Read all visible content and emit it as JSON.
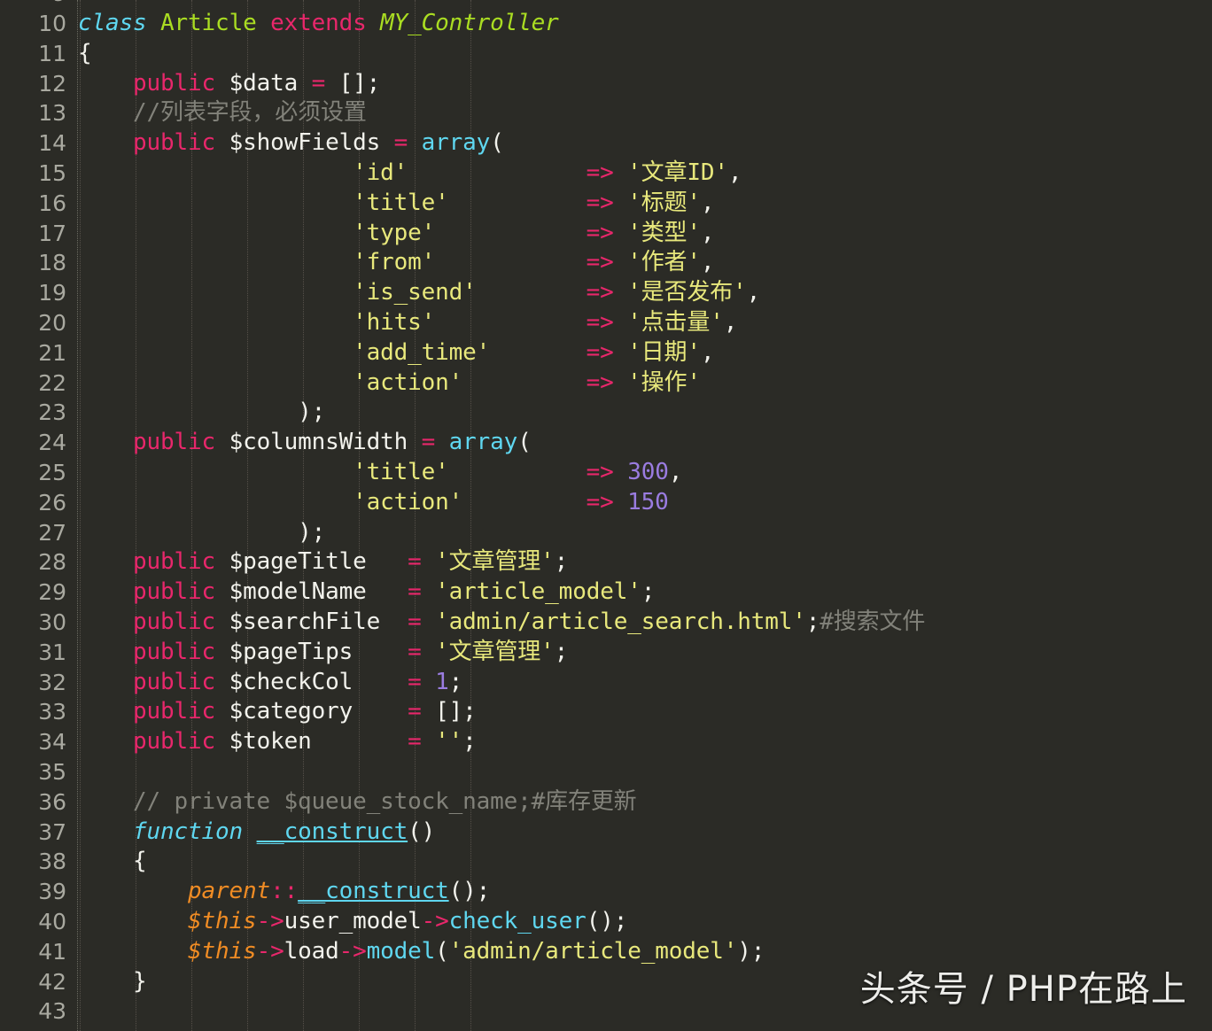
{
  "editor": {
    "language": "PHP",
    "background_color": "#2b2b26",
    "gutter_color": "#a9a9a0",
    "first_visible_line": 10,
    "last_visible_line": 43,
    "line_height_px": 33.8,
    "font_size_px": 26
  },
  "palette": {
    "keyword": "#e8276b",
    "control": "#5fd7f0",
    "class_name": "#aadd22",
    "variable": "#f2f2ec",
    "function": "#5fd7f0",
    "string": "#e8e87c",
    "number": "#9a7ce0",
    "operator": "#e8276b",
    "comment": "#82827a",
    "this_ref": "#f08c24",
    "indent_guide": "#555049"
  },
  "line_numbers": [
    10,
    11,
    12,
    13,
    14,
    15,
    16,
    17,
    18,
    19,
    20,
    21,
    22,
    23,
    24,
    25,
    26,
    27,
    28,
    29,
    30,
    31,
    32,
    33,
    34,
    35,
    36,
    37,
    38,
    39,
    40,
    41,
    42,
    43
  ],
  "code_lines": [
    {
      "n": 10,
      "text": "class Article extends MY_Controller",
      "tokens": [
        {
          "t": "class",
          "c": "t-ctrl"
        },
        {
          "t": " ",
          "c": "t-punc"
        },
        {
          "t": "Article",
          "c": "t-class"
        },
        {
          "t": " ",
          "c": "t-punc"
        },
        {
          "t": "extends",
          "c": "t-kw"
        },
        {
          "t": " ",
          "c": "t-punc"
        },
        {
          "t": "MY_Controller",
          "c": "t-classi"
        }
      ],
      "indent": 0
    },
    {
      "n": 11,
      "text": "{",
      "tokens": [
        {
          "t": "{",
          "c": "t-punc"
        }
      ],
      "indent": 0
    },
    {
      "n": 12,
      "text": "    public $data = [];",
      "tokens": [
        {
          "t": "    ",
          "c": "t-punc"
        },
        {
          "t": "public",
          "c": "t-kw"
        },
        {
          "t": " ",
          "c": "t-punc"
        },
        {
          "t": "$data",
          "c": "t-var"
        },
        {
          "t": " ",
          "c": "t-punc"
        },
        {
          "t": "=",
          "c": "t-op"
        },
        {
          "t": " ",
          "c": "t-punc"
        },
        {
          "t": "[];",
          "c": "t-punc"
        }
      ],
      "indent": 1
    },
    {
      "n": 13,
      "text": "    //列表字段，必须设置",
      "tokens": [
        {
          "t": "    ",
          "c": "t-punc"
        },
        {
          "t": "//列表字段，必须设置",
          "c": "t-cmt"
        }
      ],
      "indent": 1
    },
    {
      "n": 14,
      "text": "    public $showFields = array(",
      "tokens": [
        {
          "t": "    ",
          "c": "t-punc"
        },
        {
          "t": "public",
          "c": "t-kw"
        },
        {
          "t": " ",
          "c": "t-punc"
        },
        {
          "t": "$showFields",
          "c": "t-var"
        },
        {
          "t": " ",
          "c": "t-punc"
        },
        {
          "t": "=",
          "c": "t-op"
        },
        {
          "t": " ",
          "c": "t-punc"
        },
        {
          "t": "array",
          "c": "t-fn"
        },
        {
          "t": "(",
          "c": "t-punc"
        }
      ],
      "indent": 1
    },
    {
      "n": 15,
      "text": "                    'id'           => '文章ID',",
      "tokens": [
        {
          "t": "                    ",
          "c": "t-punc"
        },
        {
          "t": "'id'",
          "c": "t-str"
        },
        {
          "t": "             ",
          "c": "t-punc"
        },
        {
          "t": "=>",
          "c": "t-op"
        },
        {
          "t": " ",
          "c": "t-punc"
        },
        {
          "t": "'文章ID'",
          "c": "t-str"
        },
        {
          "t": ",",
          "c": "t-punc"
        }
      ],
      "indent": 5
    },
    {
      "n": 16,
      "text": "                    'title'        => '标题',",
      "tokens": [
        {
          "t": "                    ",
          "c": "t-punc"
        },
        {
          "t": "'title'",
          "c": "t-str"
        },
        {
          "t": "          ",
          "c": "t-punc"
        },
        {
          "t": "=>",
          "c": "t-op"
        },
        {
          "t": " ",
          "c": "t-punc"
        },
        {
          "t": "'标题'",
          "c": "t-str"
        },
        {
          "t": ",",
          "c": "t-punc"
        }
      ],
      "indent": 5
    },
    {
      "n": 17,
      "text": "                    'type'         => '类型',",
      "tokens": [
        {
          "t": "                    ",
          "c": "t-punc"
        },
        {
          "t": "'type'",
          "c": "t-str"
        },
        {
          "t": "           ",
          "c": "t-punc"
        },
        {
          "t": "=>",
          "c": "t-op"
        },
        {
          "t": " ",
          "c": "t-punc"
        },
        {
          "t": "'类型'",
          "c": "t-str"
        },
        {
          "t": ",",
          "c": "t-punc"
        }
      ],
      "indent": 5
    },
    {
      "n": 18,
      "text": "                    'from'         => '作者',",
      "tokens": [
        {
          "t": "                    ",
          "c": "t-punc"
        },
        {
          "t": "'from'",
          "c": "t-str"
        },
        {
          "t": "           ",
          "c": "t-punc"
        },
        {
          "t": "=>",
          "c": "t-op"
        },
        {
          "t": " ",
          "c": "t-punc"
        },
        {
          "t": "'作者'",
          "c": "t-str"
        },
        {
          "t": ",",
          "c": "t-punc"
        }
      ],
      "indent": 5
    },
    {
      "n": 19,
      "text": "                    'is_send'      => '是否发布',",
      "tokens": [
        {
          "t": "                    ",
          "c": "t-punc"
        },
        {
          "t": "'is_send'",
          "c": "t-str"
        },
        {
          "t": "        ",
          "c": "t-punc"
        },
        {
          "t": "=>",
          "c": "t-op"
        },
        {
          "t": " ",
          "c": "t-punc"
        },
        {
          "t": "'是否发布'",
          "c": "t-str"
        },
        {
          "t": ",",
          "c": "t-punc"
        }
      ],
      "indent": 5
    },
    {
      "n": 20,
      "text": "                    'hits'         => '点击量',",
      "tokens": [
        {
          "t": "                    ",
          "c": "t-punc"
        },
        {
          "t": "'hits'",
          "c": "t-str"
        },
        {
          "t": "           ",
          "c": "t-punc"
        },
        {
          "t": "=>",
          "c": "t-op"
        },
        {
          "t": " ",
          "c": "t-punc"
        },
        {
          "t": "'点击量'",
          "c": "t-str"
        },
        {
          "t": ",",
          "c": "t-punc"
        }
      ],
      "indent": 5
    },
    {
      "n": 21,
      "text": "                    'add_time'     => '日期',",
      "tokens": [
        {
          "t": "                    ",
          "c": "t-punc"
        },
        {
          "t": "'add_time'",
          "c": "t-str"
        },
        {
          "t": "       ",
          "c": "t-punc"
        },
        {
          "t": "=>",
          "c": "t-op"
        },
        {
          "t": " ",
          "c": "t-punc"
        },
        {
          "t": "'日期'",
          "c": "t-str"
        },
        {
          "t": ",",
          "c": "t-punc"
        }
      ],
      "indent": 5
    },
    {
      "n": 22,
      "text": "                    'action'       => '操作'",
      "tokens": [
        {
          "t": "                    ",
          "c": "t-punc"
        },
        {
          "t": "'action'",
          "c": "t-str"
        },
        {
          "t": "         ",
          "c": "t-punc"
        },
        {
          "t": "=>",
          "c": "t-op"
        },
        {
          "t": " ",
          "c": "t-punc"
        },
        {
          "t": "'操作'",
          "c": "t-str"
        }
      ],
      "indent": 5
    },
    {
      "n": 23,
      "text": "                );",
      "tokens": [
        {
          "t": "                ",
          "c": "t-punc"
        },
        {
          "t": ");",
          "c": "t-punc"
        }
      ],
      "indent": 4
    },
    {
      "n": 24,
      "text": "    public $columnsWidth = array(",
      "tokens": [
        {
          "t": "    ",
          "c": "t-punc"
        },
        {
          "t": "public",
          "c": "t-kw"
        },
        {
          "t": " ",
          "c": "t-punc"
        },
        {
          "t": "$columnsWidth",
          "c": "t-var"
        },
        {
          "t": " ",
          "c": "t-punc"
        },
        {
          "t": "=",
          "c": "t-op"
        },
        {
          "t": " ",
          "c": "t-punc"
        },
        {
          "t": "array",
          "c": "t-fn"
        },
        {
          "t": "(",
          "c": "t-punc"
        }
      ],
      "indent": 1
    },
    {
      "n": 25,
      "text": "                    'title'        => 300,",
      "tokens": [
        {
          "t": "                    ",
          "c": "t-punc"
        },
        {
          "t": "'title'",
          "c": "t-str"
        },
        {
          "t": "          ",
          "c": "t-punc"
        },
        {
          "t": "=>",
          "c": "t-op"
        },
        {
          "t": " ",
          "c": "t-punc"
        },
        {
          "t": "300",
          "c": "t-num"
        },
        {
          "t": ",",
          "c": "t-punc"
        }
      ],
      "indent": 5
    },
    {
      "n": 26,
      "text": "                    'action'       => 150",
      "tokens": [
        {
          "t": "                    ",
          "c": "t-punc"
        },
        {
          "t": "'action'",
          "c": "t-str"
        },
        {
          "t": "         ",
          "c": "t-punc"
        },
        {
          "t": "=>",
          "c": "t-op"
        },
        {
          "t": " ",
          "c": "t-punc"
        },
        {
          "t": "150",
          "c": "t-num"
        }
      ],
      "indent": 5
    },
    {
      "n": 27,
      "text": "                );",
      "tokens": [
        {
          "t": "                ",
          "c": "t-punc"
        },
        {
          "t": ");",
          "c": "t-punc"
        }
      ],
      "indent": 4
    },
    {
      "n": 28,
      "text": "    public $pageTitle   = '文章管理';",
      "tokens": [
        {
          "t": "    ",
          "c": "t-punc"
        },
        {
          "t": "public",
          "c": "t-kw"
        },
        {
          "t": " ",
          "c": "t-punc"
        },
        {
          "t": "$pageTitle",
          "c": "t-var"
        },
        {
          "t": "   ",
          "c": "t-punc"
        },
        {
          "t": "=",
          "c": "t-op"
        },
        {
          "t": " ",
          "c": "t-punc"
        },
        {
          "t": "'文章管理'",
          "c": "t-str"
        },
        {
          "t": ";",
          "c": "t-punc"
        }
      ],
      "indent": 1
    },
    {
      "n": 29,
      "text": "    public $modelName   = 'article_model';",
      "tokens": [
        {
          "t": "    ",
          "c": "t-punc"
        },
        {
          "t": "public",
          "c": "t-kw"
        },
        {
          "t": " ",
          "c": "t-punc"
        },
        {
          "t": "$modelName",
          "c": "t-var"
        },
        {
          "t": "   ",
          "c": "t-punc"
        },
        {
          "t": "=",
          "c": "t-op"
        },
        {
          "t": " ",
          "c": "t-punc"
        },
        {
          "t": "'article_model'",
          "c": "t-str"
        },
        {
          "t": ";",
          "c": "t-punc"
        }
      ],
      "indent": 1
    },
    {
      "n": 30,
      "text": "    public $searchFile  = 'admin/article_search.html';#搜索文件",
      "tokens": [
        {
          "t": "    ",
          "c": "t-punc"
        },
        {
          "t": "public",
          "c": "t-kw"
        },
        {
          "t": " ",
          "c": "t-punc"
        },
        {
          "t": "$searchFile",
          "c": "t-var"
        },
        {
          "t": "  ",
          "c": "t-punc"
        },
        {
          "t": "=",
          "c": "t-op"
        },
        {
          "t": " ",
          "c": "t-punc"
        },
        {
          "t": "'admin/article_search.html'",
          "c": "t-str"
        },
        {
          "t": ";",
          "c": "t-punc"
        },
        {
          "t": "#搜索文件",
          "c": "t-cmt"
        }
      ],
      "indent": 1
    },
    {
      "n": 31,
      "text": "    public $pageTips    = '文章管理';",
      "tokens": [
        {
          "t": "    ",
          "c": "t-punc"
        },
        {
          "t": "public",
          "c": "t-kw"
        },
        {
          "t": " ",
          "c": "t-punc"
        },
        {
          "t": "$pageTips",
          "c": "t-var"
        },
        {
          "t": "    ",
          "c": "t-punc"
        },
        {
          "t": "=",
          "c": "t-op"
        },
        {
          "t": " ",
          "c": "t-punc"
        },
        {
          "t": "'文章管理'",
          "c": "t-str"
        },
        {
          "t": ";",
          "c": "t-punc"
        }
      ],
      "indent": 1
    },
    {
      "n": 32,
      "text": "    public $checkCol    = 1;",
      "tokens": [
        {
          "t": "    ",
          "c": "t-punc"
        },
        {
          "t": "public",
          "c": "t-kw"
        },
        {
          "t": " ",
          "c": "t-punc"
        },
        {
          "t": "$checkCol",
          "c": "t-var"
        },
        {
          "t": "    ",
          "c": "t-punc"
        },
        {
          "t": "=",
          "c": "t-op"
        },
        {
          "t": " ",
          "c": "t-punc"
        },
        {
          "t": "1",
          "c": "t-num"
        },
        {
          "t": ";",
          "c": "t-punc"
        }
      ],
      "indent": 1
    },
    {
      "n": 33,
      "text": "    public $category    = [];",
      "tokens": [
        {
          "t": "    ",
          "c": "t-punc"
        },
        {
          "t": "public",
          "c": "t-kw"
        },
        {
          "t": " ",
          "c": "t-punc"
        },
        {
          "t": "$category",
          "c": "t-var"
        },
        {
          "t": "    ",
          "c": "t-punc"
        },
        {
          "t": "=",
          "c": "t-op"
        },
        {
          "t": " ",
          "c": "t-punc"
        },
        {
          "t": "[];",
          "c": "t-punc"
        }
      ],
      "indent": 1
    },
    {
      "n": 34,
      "text": "    public $token       = '';",
      "tokens": [
        {
          "t": "    ",
          "c": "t-punc"
        },
        {
          "t": "public",
          "c": "t-kw"
        },
        {
          "t": " ",
          "c": "t-punc"
        },
        {
          "t": "$token",
          "c": "t-var"
        },
        {
          "t": "       ",
          "c": "t-punc"
        },
        {
          "t": "=",
          "c": "t-op"
        },
        {
          "t": " ",
          "c": "t-punc"
        },
        {
          "t": "''",
          "c": "t-str"
        },
        {
          "t": ";",
          "c": "t-punc"
        }
      ],
      "indent": 1
    },
    {
      "n": 35,
      "text": "",
      "tokens": [],
      "indent": 1
    },
    {
      "n": 36,
      "text": "    // private $queue_stock_name;#库存更新",
      "tokens": [
        {
          "t": "    ",
          "c": "t-punc"
        },
        {
          "t": "// private $queue_stock_name;#库存更新",
          "c": "t-cmt"
        }
      ],
      "indent": 1
    },
    {
      "n": 37,
      "text": "    function __construct()",
      "tokens": [
        {
          "t": "    ",
          "c": "t-punc"
        },
        {
          "t": "function",
          "c": "t-ctrl"
        },
        {
          "t": " ",
          "c": "t-punc"
        },
        {
          "t": "__construct",
          "c": "t-fnu"
        },
        {
          "t": "()",
          "c": "t-punc"
        }
      ],
      "indent": 1
    },
    {
      "n": 38,
      "text": "    {",
      "tokens": [
        {
          "t": "    ",
          "c": "t-punc"
        },
        {
          "t": "{",
          "c": "t-punc"
        }
      ],
      "indent": 1
    },
    {
      "n": 39,
      "text": "        parent::__construct();",
      "tokens": [
        {
          "t": "        ",
          "c": "t-punc"
        },
        {
          "t": "parent",
          "c": "t-this"
        },
        {
          "t": "::",
          "c": "t-op"
        },
        {
          "t": "__construct",
          "c": "t-fnu"
        },
        {
          "t": "();",
          "c": "t-punc"
        }
      ],
      "indent": 2
    },
    {
      "n": 40,
      "text": "        $this->user_model->check_user();",
      "tokens": [
        {
          "t": "        ",
          "c": "t-punc"
        },
        {
          "t": "$this",
          "c": "t-this"
        },
        {
          "t": "->",
          "c": "t-op"
        },
        {
          "t": "user_model",
          "c": "t-var"
        },
        {
          "t": "->",
          "c": "t-op"
        },
        {
          "t": "check_user",
          "c": "t-fn"
        },
        {
          "t": "();",
          "c": "t-punc"
        }
      ],
      "indent": 2
    },
    {
      "n": 41,
      "text": "        $this->load->model('admin/article_model');",
      "tokens": [
        {
          "t": "        ",
          "c": "t-punc"
        },
        {
          "t": "$this",
          "c": "t-this"
        },
        {
          "t": "->",
          "c": "t-op"
        },
        {
          "t": "load",
          "c": "t-var"
        },
        {
          "t": "->",
          "c": "t-op"
        },
        {
          "t": "model",
          "c": "t-fn"
        },
        {
          "t": "(",
          "c": "t-punc"
        },
        {
          "t": "'admin/article_model'",
          "c": "t-str"
        },
        {
          "t": ");",
          "c": "t-punc"
        }
      ],
      "indent": 2
    },
    {
      "n": 42,
      "text": "    }",
      "tokens": [
        {
          "t": "    ",
          "c": "t-punc"
        },
        {
          "t": "}",
          "c": "t-punc"
        }
      ],
      "indent": 1
    },
    {
      "n": 43,
      "text": "",
      "tokens": [],
      "indent": 0
    }
  ],
  "indent_guides_x": [
    2,
    65,
    128,
    191,
    254,
    317,
    380,
    443
  ],
  "watermark": {
    "text": "头条号 / PHP在路上"
  }
}
